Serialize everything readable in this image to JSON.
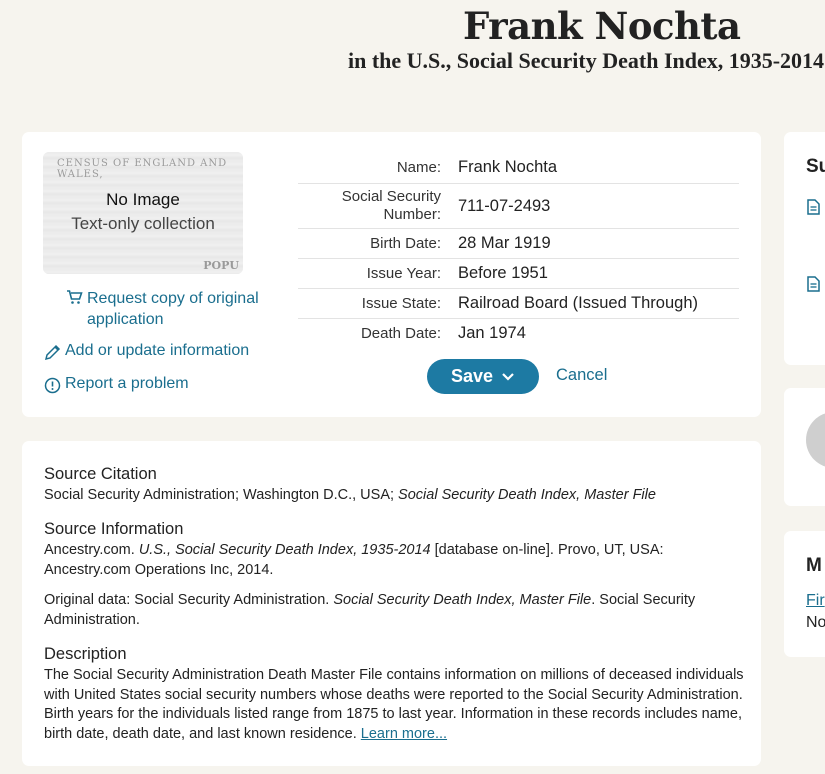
{
  "record": {
    "name": "Frank Nochta",
    "collection": "in the U.S., Social Security Death Index, 1935-2014"
  },
  "image_panel": {
    "no_image": "No Image",
    "text_only": "Text-only collection",
    "thumb_header": "CENSUS OF ENGLAND AND WALES,",
    "thumb_footer": "POPU"
  },
  "actions": {
    "request_copy": "Request copy of original application",
    "add_update": "Add or update information",
    "report_problem": "Report a problem"
  },
  "facts": [
    {
      "label": "Name:",
      "value": "Frank Nochta"
    },
    {
      "label": "Social Security Number:",
      "value": "711-07-2493"
    },
    {
      "label": "Birth Date:",
      "value": "28 Mar 1919"
    },
    {
      "label": "Issue Year:",
      "value": "Before 1951"
    },
    {
      "label": "Issue State:",
      "value": "Railroad Board (Issued Through)"
    },
    {
      "label": "Death Date:",
      "value": "Jan 1974"
    }
  ],
  "buttons": {
    "save": "Save",
    "cancel": "Cancel"
  },
  "source": {
    "citation_heading": "Source Citation",
    "citation_plain": "Social Security Administration; Washington D.C., USA; ",
    "citation_italic": "Social Security Death Index, Master File",
    "info_heading": "Source Information",
    "info_1a": "Ancestry.com. ",
    "info_1b": "U.S., Social Security Death Index, 1935-2014",
    "info_1c": " [database on-line]. Provo, UT, USA: Ancestry.com Operations Inc, 2014.",
    "info_2a": "Original data: Social Security Administration. ",
    "info_2b": "Social Security Death Index, Master File",
    "info_2c": ". Social Security Administration.",
    "desc_heading": "Description",
    "desc_text": "The Social Security Administration Death Master File contains information on millions of deceased individuals with United States social security numbers whose deaths were reported to the Social Security Administration. Birth years for the individuals listed range from 1875 to last year. Information in these records includes name, birth date, death date, and last known residence. ",
    "learn_more": "Learn more..."
  },
  "side": {
    "card1_title_partial": "Su",
    "card3_title_partial": "M",
    "card3_link_partial": "Fir",
    "card3_text_partial": "No"
  },
  "colors": {
    "accent": "#1d7aa3",
    "link": "#1a6e8e",
    "background": "#f6f4ee"
  }
}
